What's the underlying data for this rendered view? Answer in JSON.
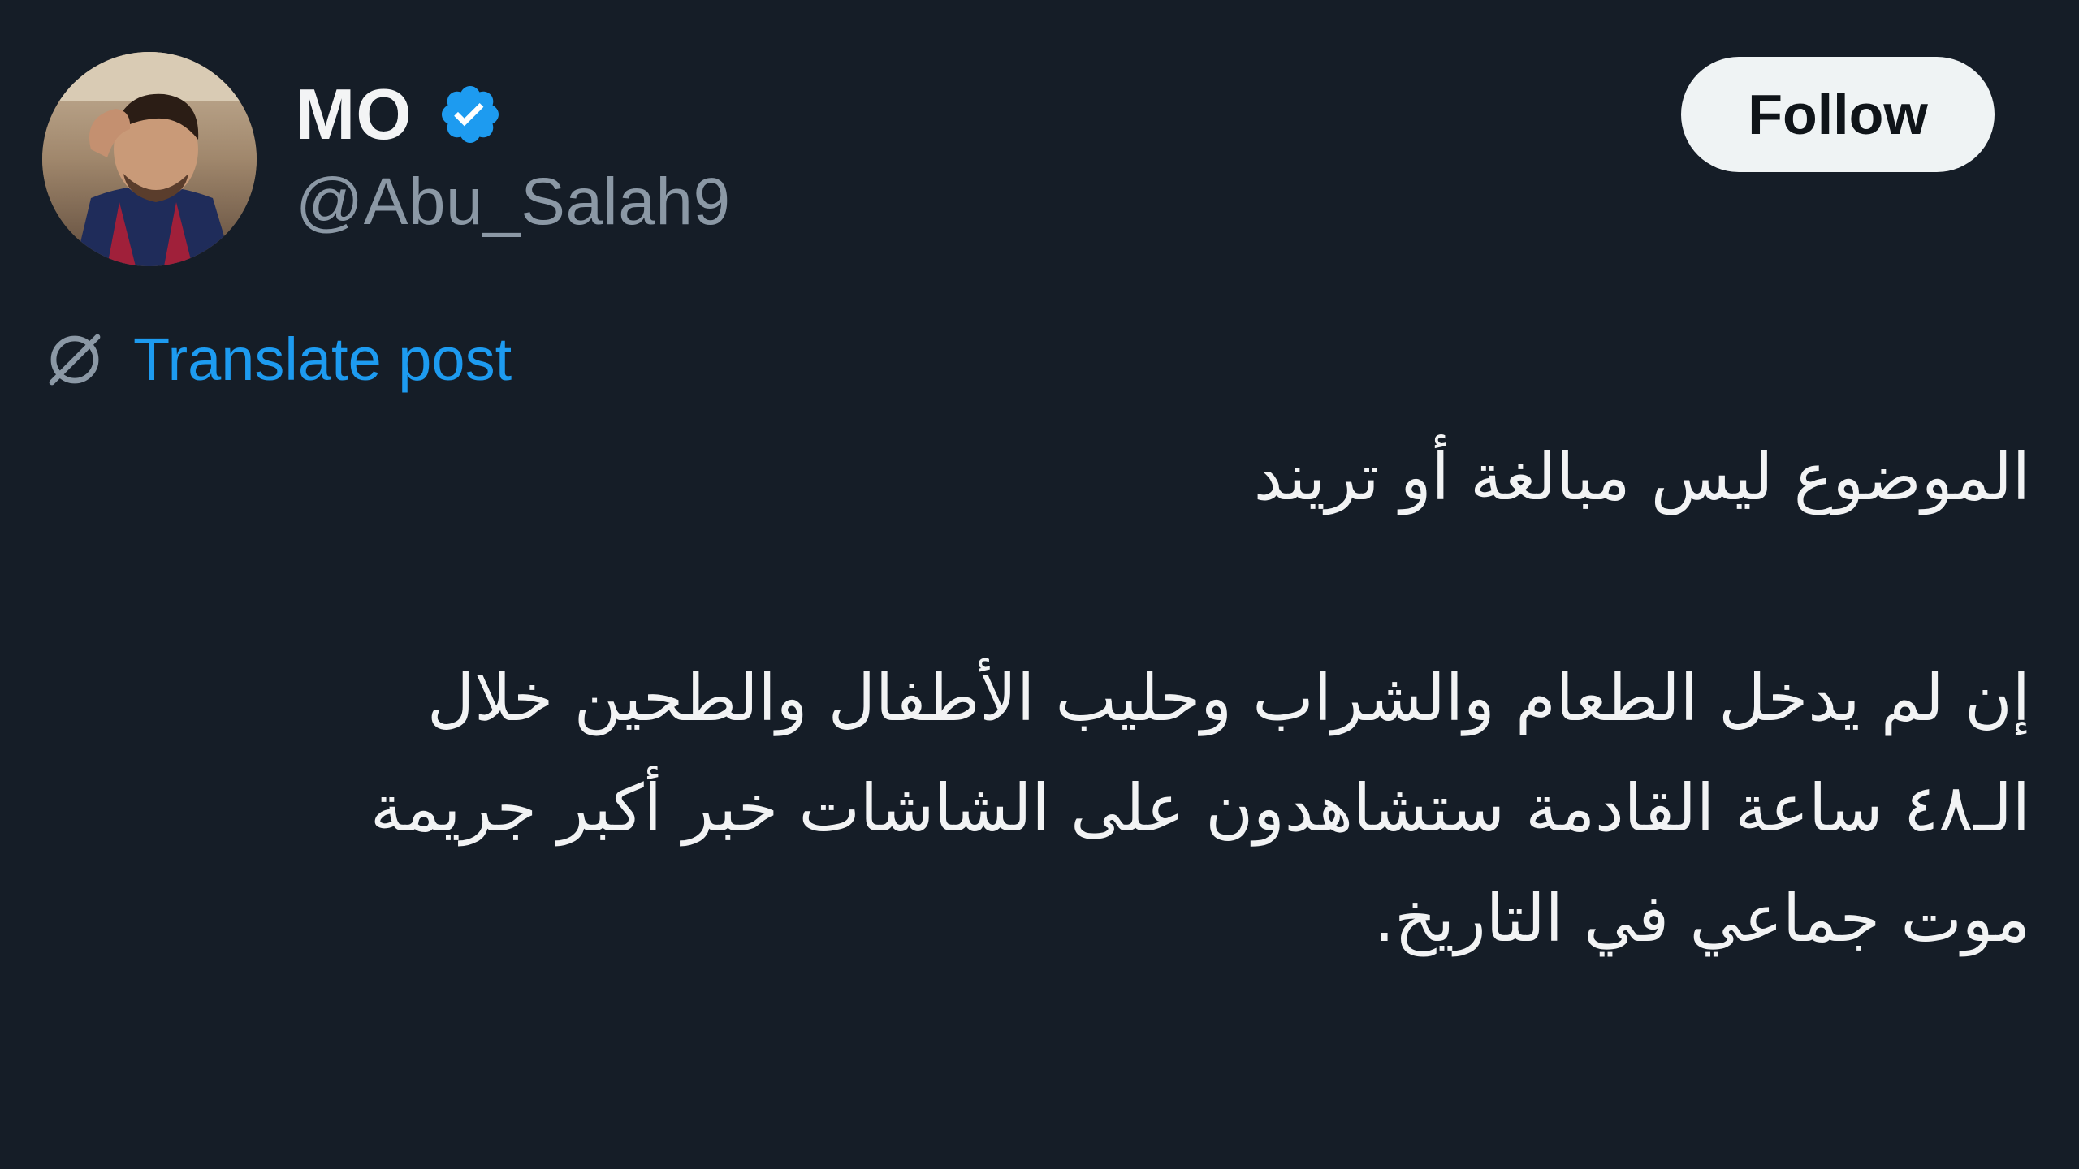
{
  "author": {
    "display_name": "MO",
    "handle": "@Abu_Salah9",
    "verified_icon": "verified-badge-icon",
    "avatar": "profile-photo"
  },
  "actions": {
    "follow_label": "Follow"
  },
  "translate": {
    "icon": "globe-icon",
    "label": "Translate post"
  },
  "post": {
    "line1": "الموضوع ليس مبالغة أو تريند",
    "line2": "إن لم يدخل الطعام والشراب وحليب الأطفال والطحين خلال",
    "line3": "الـ٤٨ ساعة القادمة ستشاهدون على الشاشات خبر أكبر جريمة",
    "line4": "موت جماعي في التاريخ."
  },
  "colors": {
    "background": "#151d27",
    "accent": "#1d9bf0",
    "handle": "#8b98a5",
    "text": "#f2f3f4"
  }
}
